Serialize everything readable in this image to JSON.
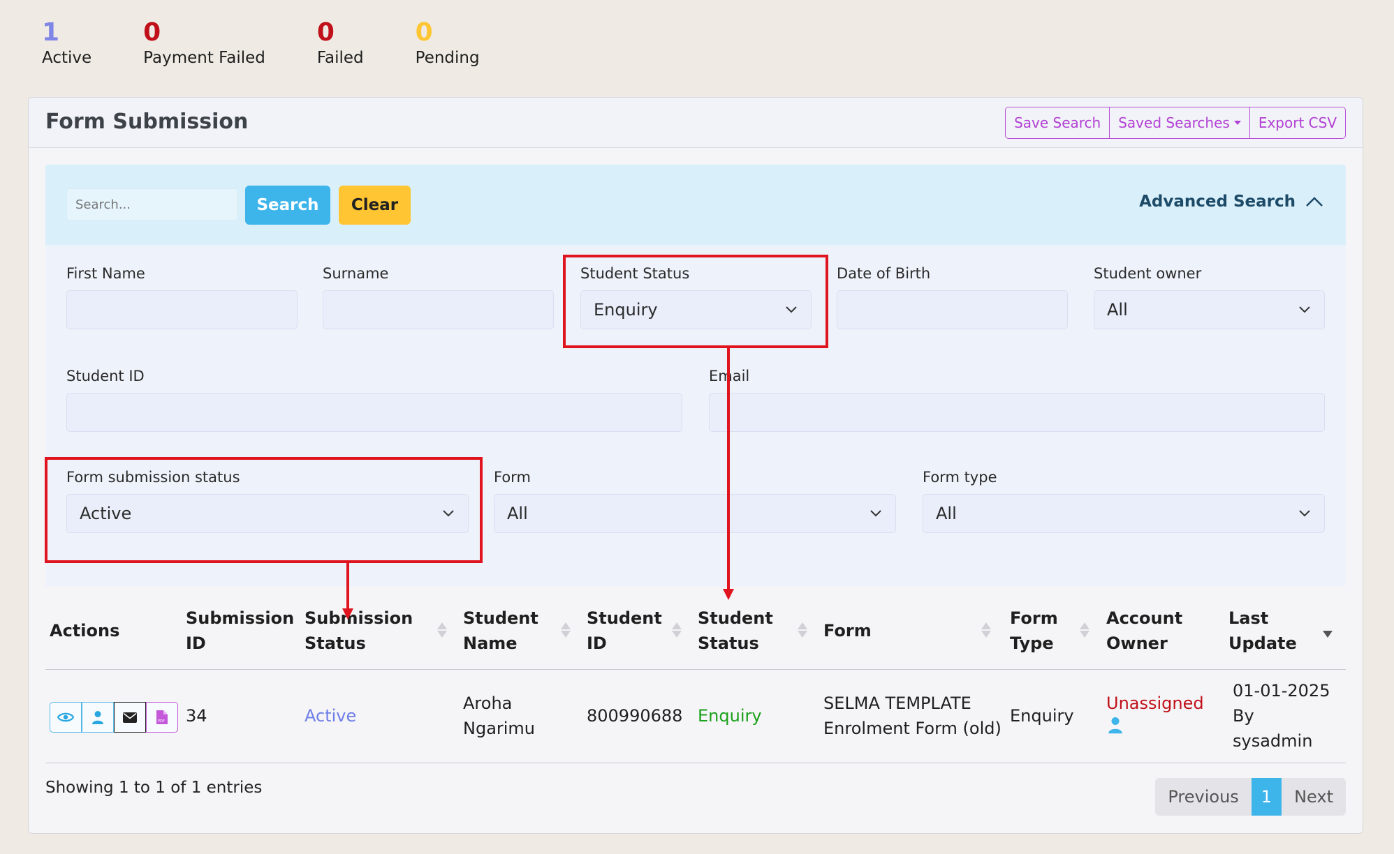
{
  "stats": [
    {
      "value": "1",
      "label": "Active",
      "color": "#7f86e6"
    },
    {
      "value": "0",
      "label": "Payment Failed",
      "color": "#c0101a"
    },
    {
      "value": "0",
      "label": "Failed",
      "color": "#c0101a"
    },
    {
      "value": "0",
      "label": "Pending",
      "color": "#ffc533"
    }
  ],
  "card": {
    "title": "Form Submission",
    "buttons": {
      "save_search": "Save Search",
      "saved_searches": "Saved Searches",
      "export_csv": "Export CSV"
    }
  },
  "search": {
    "placeholder": "Search...",
    "search_button": "Search",
    "clear_button": "Clear",
    "advanced_label": "Advanced Search"
  },
  "filters": {
    "first_name": {
      "label": "First Name",
      "value": ""
    },
    "surname": {
      "label": "Surname",
      "value": ""
    },
    "student_status": {
      "label": "Student Status",
      "value": "Enquiry"
    },
    "date_of_birth": {
      "label": "Date of Birth",
      "value": ""
    },
    "student_owner": {
      "label": "Student owner",
      "value": "All"
    },
    "student_id": {
      "label": "Student ID",
      "value": ""
    },
    "email": {
      "label": "Email",
      "value": ""
    },
    "form_submission_status": {
      "label": "Form submission status",
      "value": "Active"
    },
    "form": {
      "label": "Form",
      "value": "All"
    },
    "form_type": {
      "label": "Form type",
      "value": "All"
    }
  },
  "table": {
    "headers": {
      "actions": "Actions",
      "submission_id_1": "Submission",
      "submission_id_2": "ID",
      "submission_status_1": "Submission",
      "submission_status_2": "Status",
      "student_name_1": "Student",
      "student_name_2": "Name",
      "student_id_1": "Student",
      "student_id_2": "ID",
      "student_status_1": "Student",
      "student_status_2": "Status",
      "form": "Form",
      "form_type_1": "Form",
      "form_type_2": "Type",
      "account_owner_1": "Account",
      "account_owner_2": "Owner",
      "last_update_1": "Last",
      "last_update_2": "Update"
    },
    "rows": [
      {
        "submission_id": "34",
        "submission_status": "Active",
        "student_name_1": "Aroha",
        "student_name_2": "Ngarimu",
        "student_id": "800990688",
        "student_status": "Enquiry",
        "form_1": "SELMA TEMPLATE",
        "form_2": "Enrolment Form (old)",
        "form_type": "Enquiry",
        "account_owner": "Unassigned",
        "last_update_1": "01-01-2025",
        "last_update_2": "By",
        "last_update_3": "sysadmin"
      }
    ]
  },
  "footer": {
    "info": "Showing 1 to 1 of 1 entries",
    "previous": "Previous",
    "current_page": "1",
    "next": "Next"
  },
  "colors": {
    "accent_blue": "#3db5eb",
    "accent_yellow": "#ffc533",
    "accent_purple": "#b23fd4",
    "status_active": "#6e7ee8",
    "status_enquiry": "#1aa01a",
    "unassigned_red": "#c0101a",
    "annotation_red": "#e0141e"
  }
}
